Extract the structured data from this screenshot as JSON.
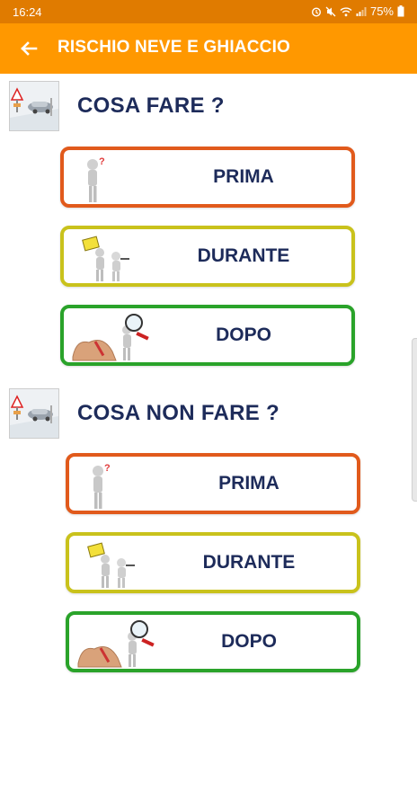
{
  "status": {
    "time": "16:24",
    "battery": "75%"
  },
  "appbar": {
    "title": "RISCHIO NEVE E GHIACCIO"
  },
  "sections": [
    {
      "heading": "COSA FARE ?",
      "buttons": [
        {
          "label": "PRIMA",
          "color": "#e15a1c"
        },
        {
          "label": "DURANTE",
          "color": "#c9c21c"
        },
        {
          "label": "DOPO",
          "color": "#2aa32a"
        }
      ]
    },
    {
      "heading": "COSA NON FARE ?",
      "buttons": [
        {
          "label": "PRIMA",
          "color": "#e15a1c"
        },
        {
          "label": "DURANTE",
          "color": "#c9c21c"
        },
        {
          "label": "DOPO",
          "color": "#2aa32a"
        }
      ]
    }
  ],
  "colors": {
    "appbar": "#ff9800",
    "statusbar": "#e07b00",
    "heading_text": "#1d2b5a"
  }
}
